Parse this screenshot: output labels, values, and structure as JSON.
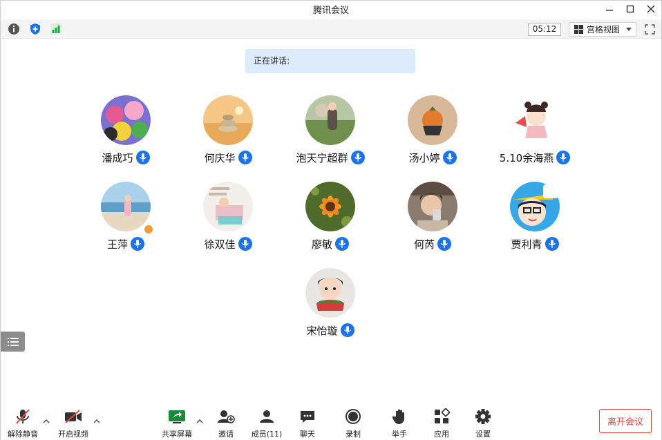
{
  "window": {
    "title": "腾讯会议"
  },
  "topbar": {
    "timer": "05:12",
    "view_label": "宫格视图"
  },
  "speaking": {
    "label": "正在讲话:"
  },
  "participants": [
    {
      "name": "潘成巧"
    },
    {
      "name": "何庆华"
    },
    {
      "name": "泡天宁超群"
    },
    {
      "name": "汤小婷"
    },
    {
      "name": "5.10余海燕"
    },
    {
      "name": "王萍"
    },
    {
      "name": "徐双佳"
    },
    {
      "name": "廖敏"
    },
    {
      "name": "何芮"
    },
    {
      "name": "贾利青"
    },
    {
      "name": "宋怡璇"
    }
  ],
  "toolbar": {
    "unmute": "解除静音",
    "video": "开启视频",
    "share": "共享屏幕",
    "invite": "邀请",
    "members": "成员(11)",
    "chat": "聊天",
    "record": "录制",
    "raise_hand": "举手",
    "apps": "应用",
    "settings": "设置",
    "leave": "离开会议"
  },
  "colors": {
    "accent": "#1a73e8",
    "leave": "#e2463f",
    "banner": "#dcebfb"
  }
}
